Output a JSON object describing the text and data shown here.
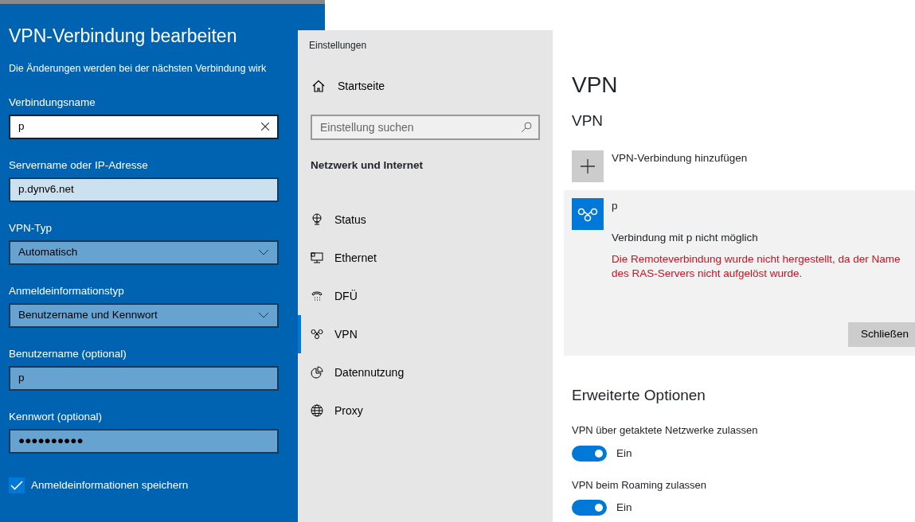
{
  "dialog": {
    "title": "VPN-Verbindung bearbeiten",
    "description": "Die Änderungen werden bei der nächsten Verbindung wirk",
    "fields": [
      {
        "kind": "textbox",
        "label": "Verbindungsname",
        "value": "p",
        "focused": true,
        "hovered": false
      },
      {
        "kind": "textbox",
        "label": "Servername oder IP-Adresse",
        "value": "p.dynv6.net",
        "focused": false,
        "hovered": true
      },
      {
        "kind": "dropdown",
        "label": "VPN-Typ",
        "value": "Automatisch",
        "focused": false,
        "hovered": false
      },
      {
        "kind": "dropdown",
        "label": "Anmeldeinformationstyp",
        "value": "Benutzername und Kennwort",
        "focused": false,
        "hovered": false
      },
      {
        "kind": "textbox",
        "label": "Benutzername (optional)",
        "value": "p",
        "focused": false,
        "hovered": false
      },
      {
        "kind": "password",
        "label": "Kennwort (optional)",
        "value": "●●●●●●●●●●",
        "focused": false,
        "hovered": false
      }
    ],
    "checkbox": {
      "label": "Anmeldeinformationen speichern",
      "checked": true
    }
  },
  "settings": {
    "window": {
      "title": "Einstellungen"
    },
    "sidebar": {
      "home": "Startseite",
      "search": {
        "placeholder": "Einstellung suchen"
      },
      "section": "Netzwerk und Internet",
      "items": [
        {
          "kind": "status",
          "label": "Status",
          "selected": false
        },
        {
          "kind": "ethernet",
          "label": "Ethernet",
          "selected": false
        },
        {
          "kind": "dialup",
          "label": "DFÜ",
          "selected": false
        },
        {
          "kind": "vpn",
          "label": "VPN",
          "selected": true
        },
        {
          "kind": "data",
          "label": "Datennutzung",
          "selected": false
        },
        {
          "kind": "proxy",
          "label": "Proxy",
          "selected": false
        }
      ]
    },
    "content": {
      "title": "VPN",
      "section": "VPN",
      "add_label": "VPN-Verbindung hinzufügen",
      "connection": {
        "name": "p",
        "status": "Verbindung mit p nicht möglich",
        "error": "Die Remoteverbindung wurde nicht hergestellt, da der Name des RAS-Servers nicht aufgelöst wurde.",
        "button": "Schließen"
      },
      "advanced": {
        "title": "Erweiterte Optionen",
        "toggles": [
          {
            "label": "VPN über getaktete Netzwerke zulassen",
            "on": true,
            "state_text": "Ein"
          },
          {
            "label": "VPN beim Roaming zulassen",
            "on": true,
            "state_text": "Ein"
          }
        ]
      }
    }
  }
}
